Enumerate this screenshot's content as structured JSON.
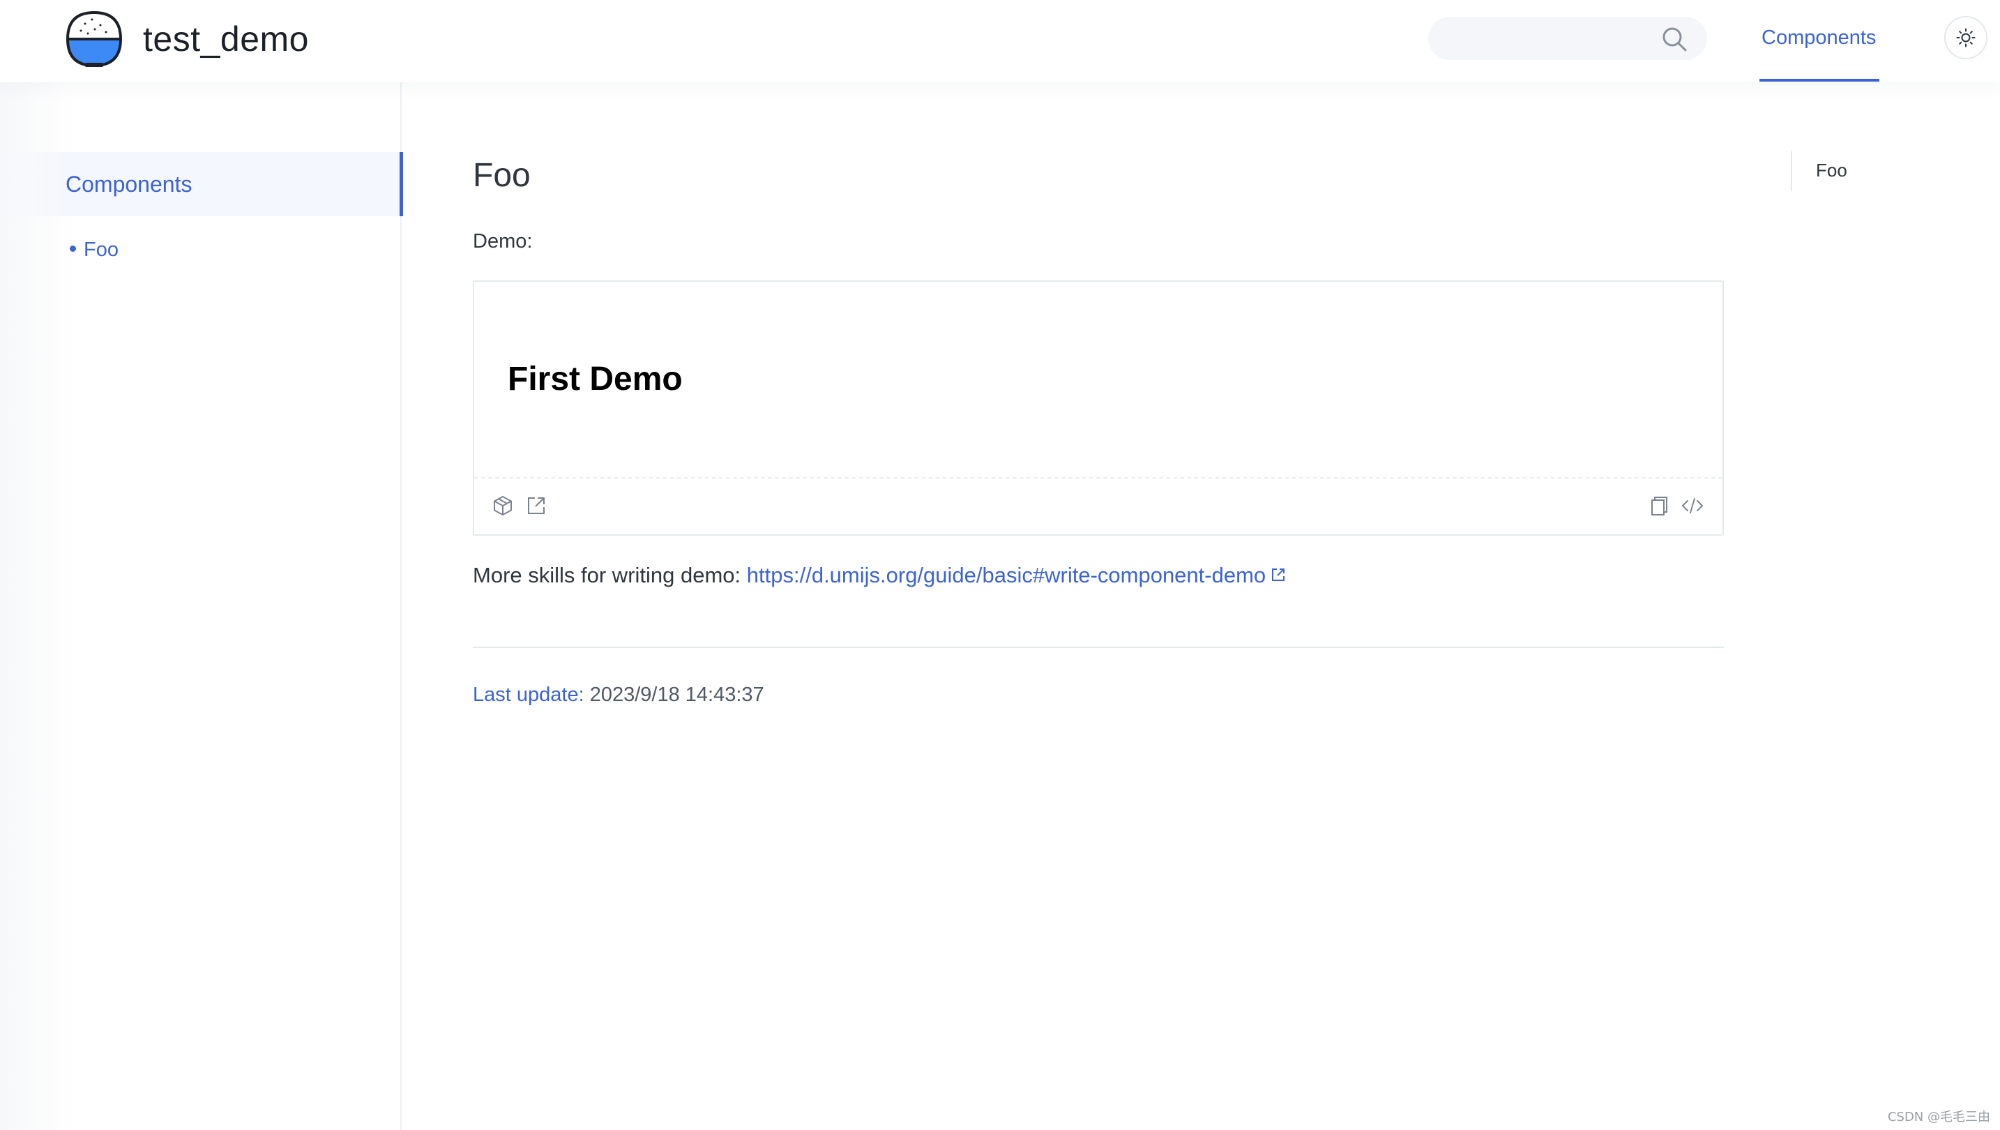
{
  "header": {
    "site_title": "test_demo",
    "logo_icon": "rice-bowl-logo-icon",
    "search": {
      "placeholder": "",
      "value": "",
      "icon": "search-icon"
    },
    "nav": [
      {
        "label": "Components",
        "active": true
      }
    ],
    "theme_toggle_icon": "sun-icon"
  },
  "sidebar": {
    "group_title": "Components",
    "items": [
      {
        "label": "Foo",
        "active": true
      }
    ]
  },
  "main": {
    "title": "Foo",
    "demo_label": "Demo:",
    "demo": {
      "heading": "First Demo",
      "actions_left": [
        "codesandbox-icon",
        "open-external-icon"
      ],
      "actions_right": [
        "copy-icon",
        "code-icon"
      ]
    },
    "more": {
      "text": "More skills for writing demo: ",
      "link": "https://d.umijs.org/guide/basic#write-component-demo"
    },
    "last_update": {
      "label": "Last update:",
      "value": "2023/9/18 14:43:37"
    }
  },
  "toc": {
    "items": [
      "Foo"
    ]
  },
  "watermark": "CSDN @毛毛三由",
  "colors": {
    "accent": "#3b63d6",
    "text": "#30363f",
    "border": "#e4e9ef"
  }
}
